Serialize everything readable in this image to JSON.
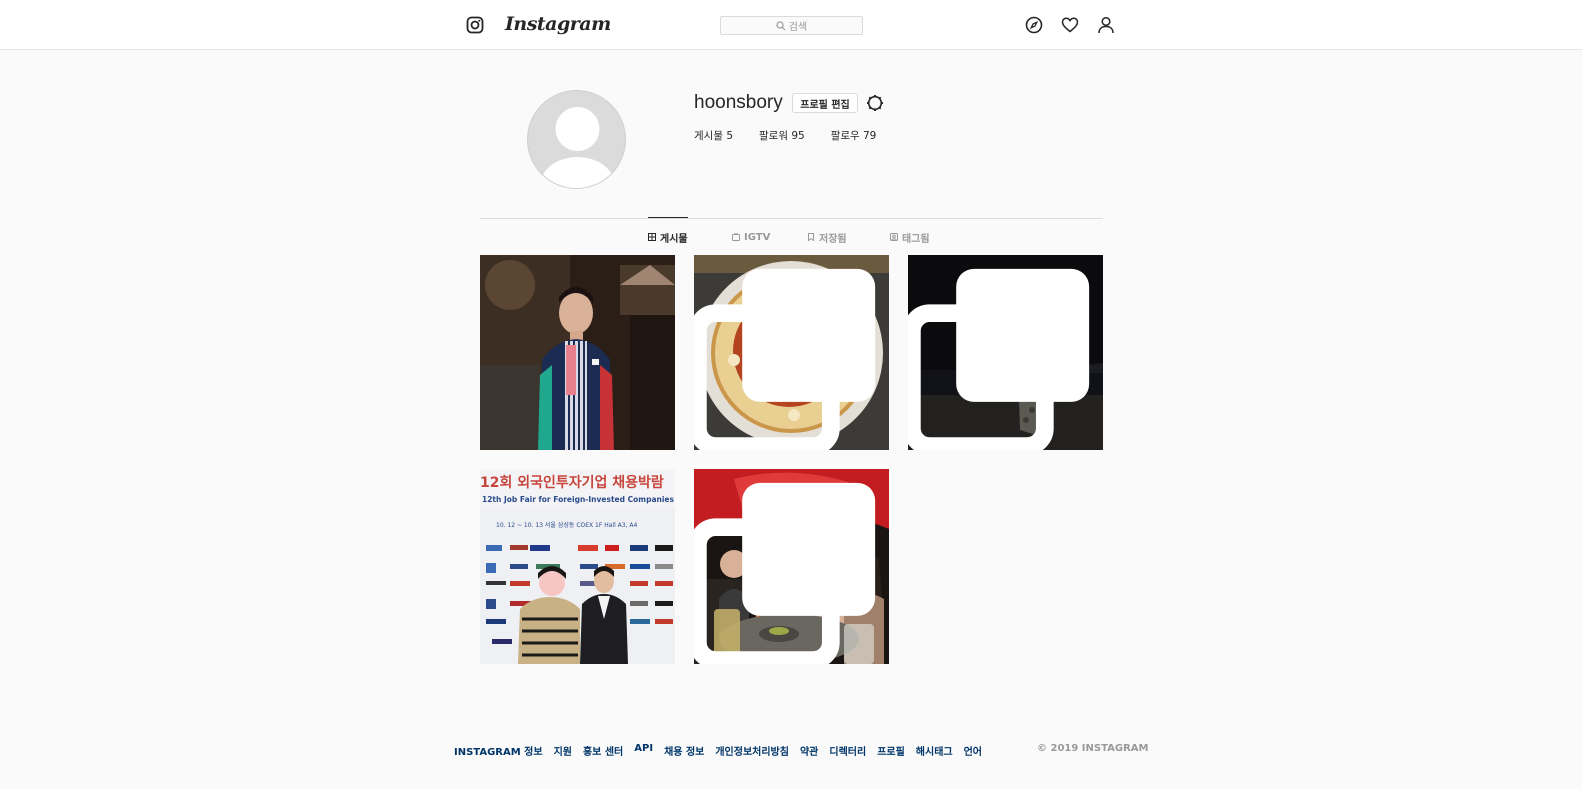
{
  "header": {
    "wordmark": "Instagram",
    "search_placeholder": "검색",
    "icons": [
      "instagram-glyph-icon",
      "explore-compass-icon",
      "heart-icon",
      "user-icon"
    ]
  },
  "profile": {
    "username": "hoonsbory",
    "edit_label": "프로필 편집",
    "stats": {
      "posts": "게시물 5",
      "followers": "팔로워 95",
      "following": "팔로우 79"
    }
  },
  "tabs": [
    {
      "label": "게시물",
      "active": true
    },
    {
      "label": "IGTV",
      "active": false
    },
    {
      "label": "저장됨",
      "active": false
    },
    {
      "label": "태그됨",
      "active": false
    }
  ],
  "posts": [
    {
      "subject": "person-portrait",
      "multi": false
    },
    {
      "subject": "food-dish",
      "multi": true
    },
    {
      "subject": "night-beach",
      "multi": true
    },
    {
      "subject": "job-fair",
      "multi": false
    },
    {
      "subject": "friends-umbrella",
      "multi": true
    }
  ],
  "job_fair_banner": {
    "line1": "12회 외국인투자기업 채용박람",
    "line2": "12th Job Fair for Foreign-Invested Companies 2",
    "line3": "10. 12 ~ 10. 13  서울 삼성동 COEX   1F Hall A3, A4"
  },
  "footer": {
    "links": [
      "INSTAGRAM 정보",
      "지원",
      "홍보 센터",
      "API",
      "채용 정보",
      "개인정보처리방침",
      "약관",
      "디렉터리",
      "프로필",
      "해시태그",
      "언어"
    ],
    "copyright": "© 2019 INSTAGRAM"
  },
  "colors": {
    "background": "#fafafa",
    "link": "#003569",
    "muted": "#999999",
    "text": "#262626"
  }
}
